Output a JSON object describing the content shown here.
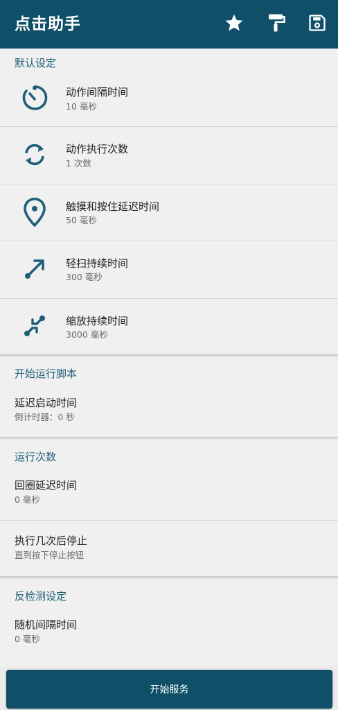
{
  "app": {
    "title": "点击助手",
    "icons": [
      "star-icon",
      "paint-roller-icon",
      "save-icon"
    ],
    "primary_color": "#0f5068",
    "accent_color": "#1f5f79"
  },
  "sections": {
    "defaults": {
      "header": "默认设定",
      "items": [
        {
          "icon": "timer-icon",
          "title": "动作间隔时间",
          "subtitle": "10 毫秒"
        },
        {
          "icon": "repeat-icon",
          "title": "动作执行次数",
          "subtitle": "1 次数"
        },
        {
          "icon": "location-pin-icon",
          "title": "触摸和按住延迟时间",
          "subtitle": "50 毫秒"
        },
        {
          "icon": "swipe-arrow-icon",
          "title": "轻扫持续时间",
          "subtitle": "300 毫秒"
        },
        {
          "icon": "pinch-zoom-icon",
          "title": "缩放持续时间",
          "subtitle": "3000 毫秒"
        }
      ]
    },
    "start_script": {
      "header": "开始运行脚本",
      "items": [
        {
          "title": "延迟启动时间",
          "subtitle": "倒计时器：0 秒"
        }
      ]
    },
    "run_count": {
      "header": "运行次数",
      "items": [
        {
          "title": "回圈延迟时间",
          "subtitle": "0 毫秒"
        },
        {
          "title": "执行几次后停止",
          "subtitle": "直到按下停止按钮"
        }
      ]
    },
    "anti_detect": {
      "header": "反检测设定",
      "items": [
        {
          "title": "随机间隔时间",
          "subtitle": "0 毫秒"
        }
      ]
    }
  },
  "footer": {
    "start_button_label": "开始服务"
  }
}
